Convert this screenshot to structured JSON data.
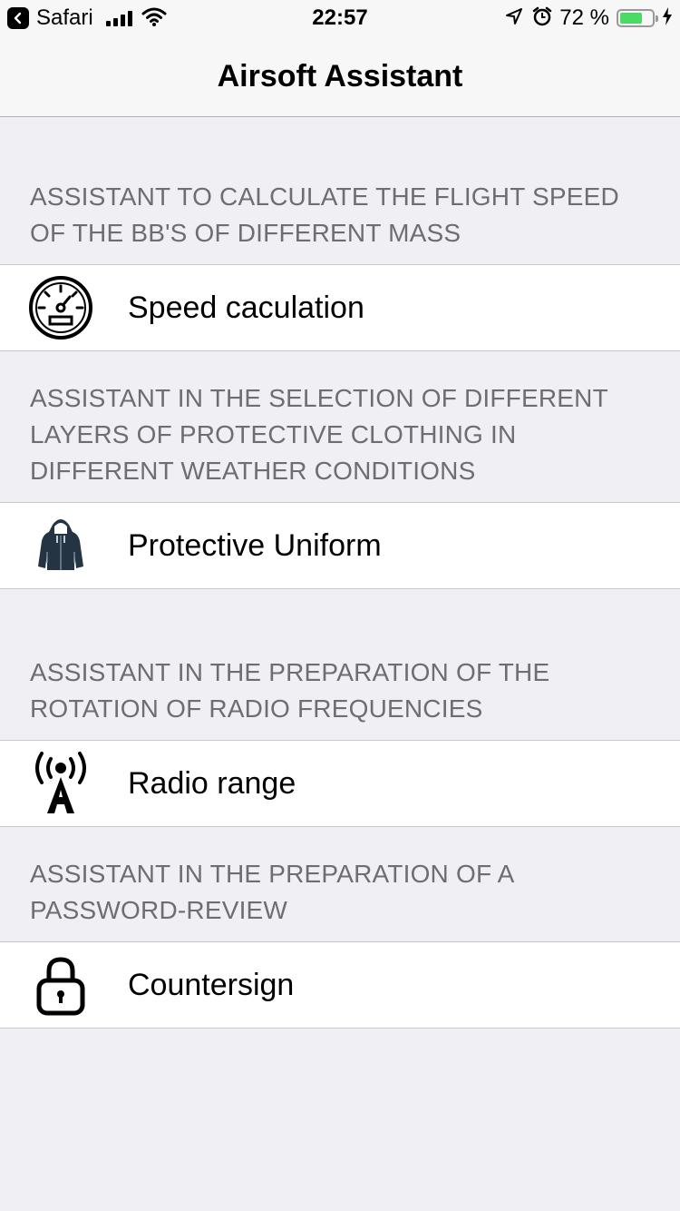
{
  "status_bar": {
    "back_app": "Safari",
    "time": "22:57",
    "battery_percent": "72 %",
    "battery_level": 0.72
  },
  "nav": {
    "title": "Airsoft Assistant"
  },
  "sections": [
    {
      "header": "ASSISTANT TO CALCULATE THE FLIGHT SPEED OF THE BB'S OF DIFFERENT MASS",
      "item_label": "Speed caculation",
      "icon": "speedometer-icon"
    },
    {
      "header": "ASSISTANT IN THE SELECTION OF DIFFERENT LAYERS OF PROTECTIVE CLOTHING IN DIFFERENT WEATHER CONDITIONS",
      "item_label": "Protective Uniform",
      "icon": "jacket-icon"
    },
    {
      "header": "ASSISTANT IN THE PREPARATION OF THE ROTATION OF RADIO FREQUENCIES",
      "item_label": "Radio range",
      "icon": "radio-tower-icon"
    },
    {
      "header": "ASSISTANT IN THE PREPARATION OF A PASSWORD-REVIEW",
      "item_label": "Countersign",
      "icon": "lock-icon"
    }
  ]
}
